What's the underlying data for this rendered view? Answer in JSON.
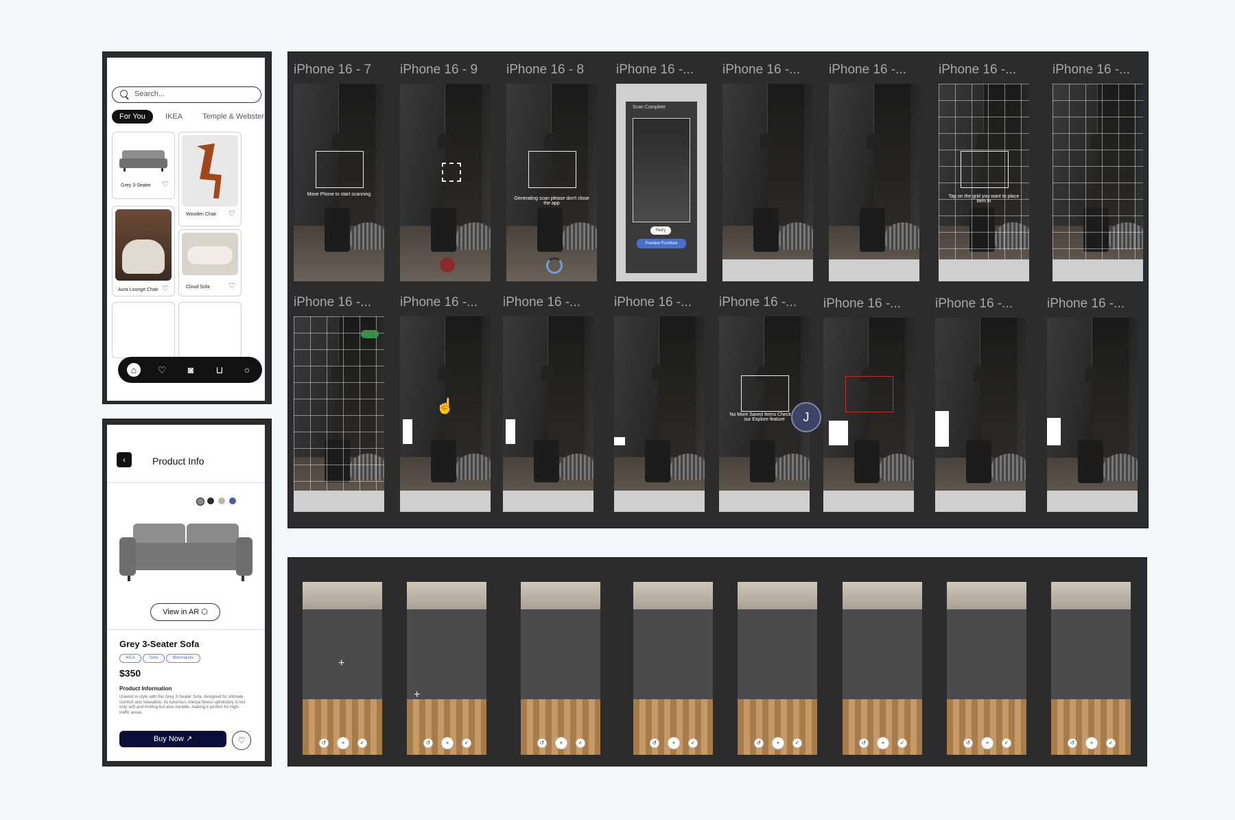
{
  "home": {
    "search_placeholder": "Search...",
    "chips": [
      "For You",
      "IKEA",
      "Temple & Webster"
    ],
    "cards": [
      {
        "label": "Grey 3-Seater"
      },
      {
        "label": "Wooden Chair"
      },
      {
        "label": "Aura Lounge Chair"
      },
      {
        "label": "Cloud Sofa"
      }
    ],
    "nav_icons": [
      "home-icon",
      "heart-icon",
      "camera-icon",
      "cart-icon",
      "profile-icon"
    ]
  },
  "product": {
    "title": "Product Info",
    "colors": [
      "#8a8a8a",
      "#2a2a2a",
      "#b9b9a6",
      "#4a5fa8"
    ],
    "view_ar": "View in AR",
    "name": "Grey 3-Seater Sofa",
    "tags": [
      "IKEA",
      "Sofa",
      "Minimalistic"
    ],
    "price": "$350",
    "info_title": "Product Information",
    "info_text": "Unwind in style with the Grey 3-Seater Sofa, designed for ultimate comfort and relaxation. Its luxurious sherpa fleece upholstery is not only soft and inviting but also durable, making it perfect for high-traffic areas.",
    "buy": "Buy Now"
  },
  "frames": {
    "row1": [
      "iPhone 16 - 7",
      "iPhone 16 - 9",
      "iPhone 16 - 8",
      "iPhone 16 -...",
      "iPhone 16 -...",
      "iPhone 16 -...",
      "iPhone 16 -...",
      "iPhone 16 -..."
    ],
    "row2": [
      "iPhone 16 -...",
      "iPhone 16 -...",
      "iPhone 16 -...",
      "iPhone 16 -...",
      "iPhone 16 -...",
      "iPhone 16 -...",
      "iPhone 16 -...",
      "iPhone 16 -..."
    ],
    "captions": {
      "scan": "Move Phone to start scanning",
      "generating": "Generating scan please don't close the app",
      "scan_complete": "Scan Complete",
      "retry": "Retry",
      "preview": "Preview Furniture",
      "tap_grid": "Tap on the grid you want to place item in",
      "no_saved": "No More Saved Items Check out our Explore feature",
      "avatar": "J"
    }
  }
}
